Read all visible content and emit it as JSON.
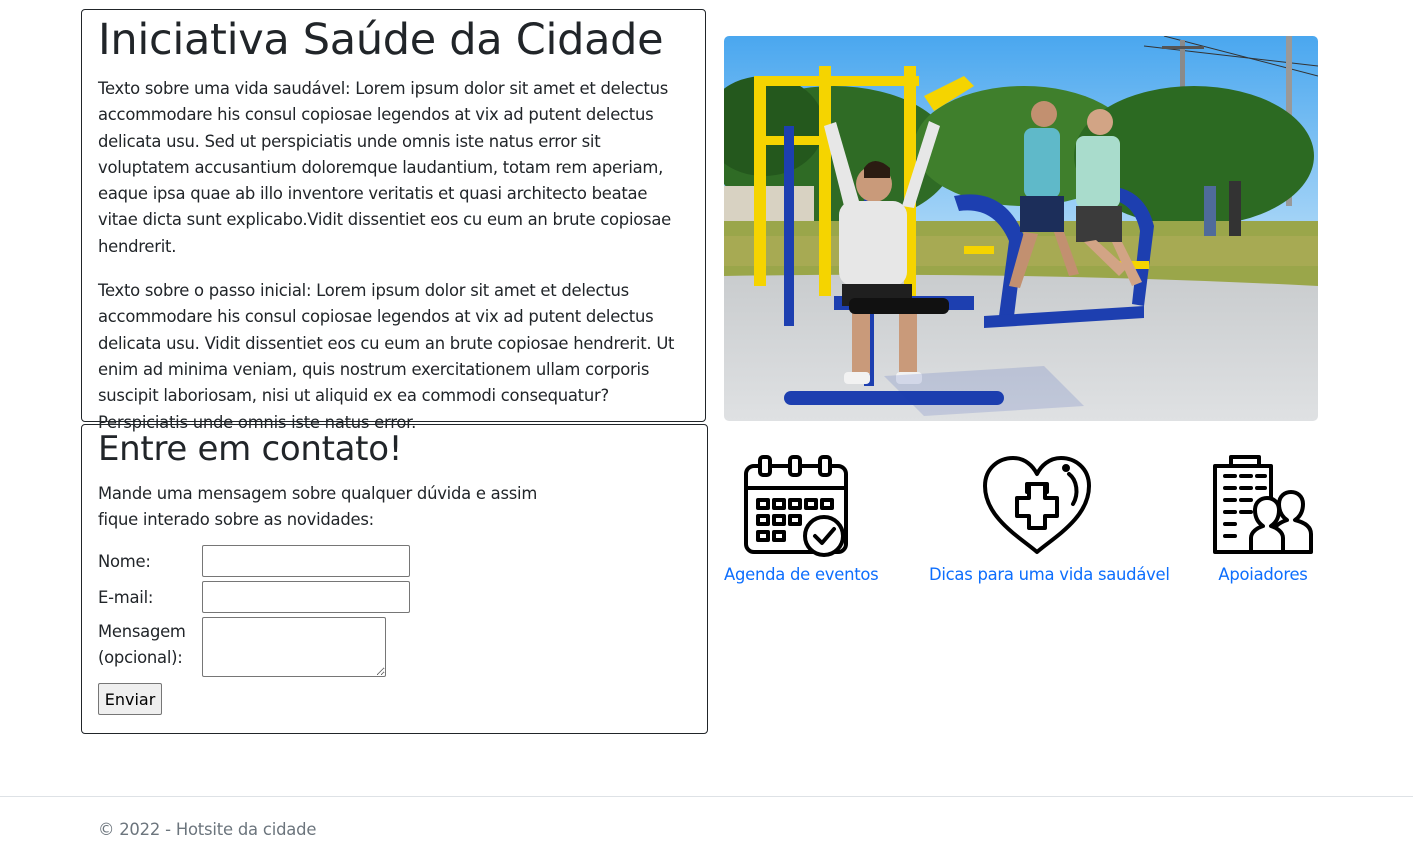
{
  "intro": {
    "title": "Iniciativa Saúde da Cidade",
    "paragraph_1": "Texto sobre uma vida saudável: Lorem ipsum dolor sit amet et delectus accommodare his consul copiosae legendos at vix ad putent delectus delicata usu. Sed ut perspiciatis unde omnis iste natus error sit voluptatem accusantium doloremque laudantium, totam rem aperiam, eaque ipsa quae ab illo inventore veritatis et quasi architecto beatae vitae dicta sunt explicabo.Vidit dissentiet eos cu eum an brute copiosae hendrerit.",
    "paragraph_2": "Texto sobre o passo inicial: Lorem ipsum dolor sit amet et delectus accommodare his consul copiosae legendos at vix ad putent delectus delicata usu. Vidit dissentiet eos cu eum an brute copiosae hendrerit. Ut enim ad minima veniam, quis nostrum exercitationem ullam corporis suscipit laboriosam, nisi ut aliquid ex ea commodi consequatur? Perspiciatis unde omnis iste natus error."
  },
  "contact": {
    "title": "Entre em contato!",
    "lead": "Mande uma mensagem sobre qualquer dúvida e assim fique interado sobre as novidades:",
    "name_label": "Nome:",
    "name_value": "",
    "email_label": "E-mail:",
    "email_value": "",
    "message_label": "Mensagem (opcional):",
    "message_value": "",
    "submit_label": "Enviar"
  },
  "hero": {
    "icon": "outdoor-gym-photo"
  },
  "features": [
    {
      "label": "Agenda de eventos",
      "icon": "calendar-check-icon"
    },
    {
      "label": "Dicas para uma vida saudável",
      "icon": "heart-plus-icon"
    },
    {
      "label": "Apoiadores",
      "icon": "building-people-icon"
    }
  ],
  "footer": {
    "text": "© 2022 - Hotsite da cidade"
  },
  "colors": {
    "link": "#0d6efd",
    "text": "#212529",
    "muted": "#6c757d",
    "equipment_yellow": "#f5d400",
    "equipment_blue": "#1d3fb0"
  }
}
